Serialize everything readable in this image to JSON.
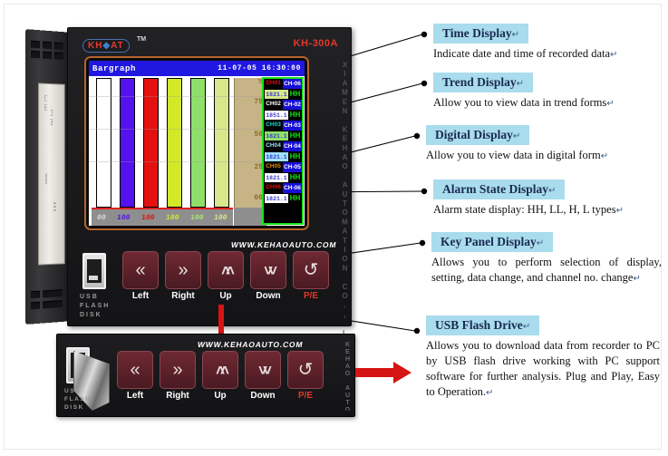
{
  "device": {
    "brand": "KH",
    "brand_mid": "◆",
    "brand_end": "AT",
    "trademark": "TM",
    "model": "KH-300A",
    "company_vertical": "XIAMEN KEHAO AUTOMATION CO., LTD.",
    "website": "WWW.KEHAOAUTO.COM",
    "usb_label_line1": "USB",
    "usb_label_line2": "FLASH",
    "usb_label_line3": "DISK",
    "screen": {
      "title": "Bargraph",
      "datetime": "11-07-05 16:30:00",
      "percent_symbol": "%",
      "scale_ticks": [
        "75",
        "50",
        "25",
        "00"
      ],
      "bars": [
        {
          "label": "00",
          "color": "#ffffff",
          "height_pct": 100,
          "text_color": "#d8d8d8"
        },
        {
          "label": "100",
          "color": "#5511ee",
          "height_pct": 100,
          "text_color": "#5511ee"
        },
        {
          "label": "100",
          "color": "#e51010",
          "height_pct": 100,
          "text_color": "#e51010"
        },
        {
          "label": "100",
          "color": "#d4e82a",
          "height_pct": 100,
          "text_color": "#d4e82a"
        },
        {
          "label": "100",
          "color": "#8fe06a",
          "height_pct": 100,
          "text_color": "#a8e27a"
        },
        {
          "label": "100",
          "color": "#d7e78c",
          "height_pct": 100,
          "text_color": "#d7e78c"
        }
      ],
      "channels": [
        {
          "tag": "CH01",
          "tag_color": "#e51010",
          "name": "CH-06",
          "value": "1821.1",
          "value_color": "#d7e78c",
          "alarm": "HH"
        },
        {
          "tag": "CH02",
          "tag_color": "#ffffff",
          "name": "CH-02",
          "value": "1851.1",
          "value_color": "#ffffff",
          "alarm": "HH"
        },
        {
          "tag": "CH03",
          "tag_color": "#19d8d8",
          "name": "CH-03",
          "value": "1821.1",
          "value_color": "#8fe06a",
          "alarm": "HH"
        },
        {
          "tag": "CH04",
          "tag_color": "#9fe0ff",
          "name": "CH-04",
          "value": "1821.1",
          "value_color": "#9fe0ff",
          "alarm": "HH"
        },
        {
          "tag": "CH05",
          "tag_color": "#e58b10",
          "name": "CH-05",
          "value": "1821.1",
          "value_color": "#ffffff",
          "alarm": "HH"
        },
        {
          "tag": "CH06",
          "tag_color": "#e51010",
          "name": "CH-06",
          "value": "1821.1",
          "value_color": "#ffffff",
          "alarm": "HH"
        }
      ]
    },
    "keys": [
      {
        "glyph": "«",
        "label": "Left",
        "name": "left"
      },
      {
        "glyph": "»",
        "label": "Right",
        "name": "right"
      },
      {
        "glyph": "˄˄",
        "label": "Up",
        "name": "up"
      },
      {
        "glyph": "˅˅",
        "label": "Down",
        "name": "down"
      },
      {
        "glyph": "↺",
        "label": "P/E",
        "name": "pe"
      }
    ]
  },
  "panel_bottom": {
    "website": "WWW.KEHAOAUTO.COM",
    "company_vertical": "KEHAO AUTOMATION CO., LTD.",
    "usb_label_line1": "USB",
    "usb_label_line2": "FLASH",
    "usb_label_line3": "DISK"
  },
  "callouts": [
    {
      "title": "Time Display",
      "pilcrow": "↵",
      "desc": "Indicate date and time of recorded data",
      "desc_pilcrow": "↵"
    },
    {
      "title": "Trend Display",
      "pilcrow": "↵",
      "desc": "Allow you to view data in trend forms",
      "desc_pilcrow": "↵"
    },
    {
      "title": "Digital Display",
      "pilcrow": "↵",
      "desc": "Allow you to view data in digital form",
      "desc_pilcrow": "↵"
    },
    {
      "title": "Alarm State Display",
      "pilcrow": "↵",
      "desc": "Alarm state display: HH, LL, H, L types",
      "desc_pilcrow": "↵"
    },
    {
      "title": "Key Panel Display",
      "pilcrow": "↵",
      "desc": "Allows you to perform selection of display, setting, data change, and channel no. change",
      "desc_pilcrow": "↵"
    },
    {
      "title": "USB Flash Drive",
      "pilcrow": "↵",
      "desc": "Allows you to download data from recorder to PC by USB flash drive working with PC support software for further analysis. Plug and Play, Easy to Operation.",
      "desc_pilcrow": "↵"
    }
  ],
  "colors": {
    "callout_bg": "#a9dcec",
    "callout_text": "#1b2a52",
    "arrow_red": "#d61414",
    "model_red": "#e0392c",
    "screen_title_blue": "#2018e0",
    "alarm_green": "#19e219"
  }
}
